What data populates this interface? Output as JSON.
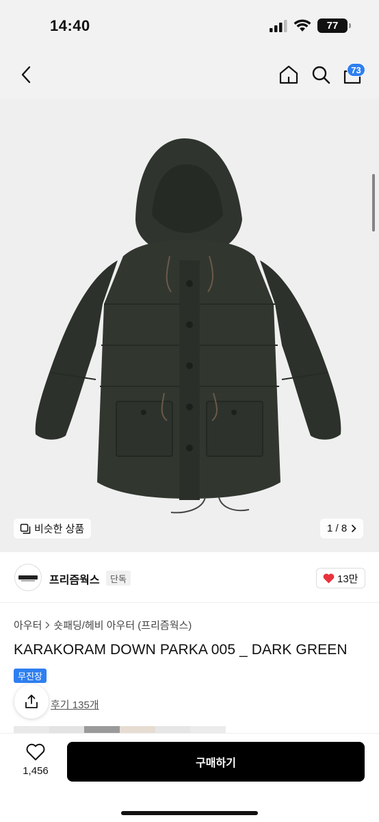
{
  "status_bar": {
    "time": "14:40",
    "battery": "77"
  },
  "nav": {
    "cart_count": "73"
  },
  "gallery": {
    "similar_label": "비슷한 상품",
    "pager": "1 / 8"
  },
  "brand": {
    "name": "프리즘웍스",
    "tag": "단독",
    "likes": "13만"
  },
  "product": {
    "breadcrumb": [
      "아우터",
      "숏패딩/헤비 아우터 (프리즘웍스)"
    ],
    "title": "KARAKORAM DOWN PARKA 005 _ DARK GREEN",
    "shipping_badge": "무진장",
    "reviews": "후기 135개"
  },
  "bottom": {
    "wish_count": "1,456",
    "buy_label": "구매하기"
  },
  "colors": {
    "accent": "#2f7ff0",
    "jacket": "#2f342f",
    "heart": "#e8323c"
  }
}
